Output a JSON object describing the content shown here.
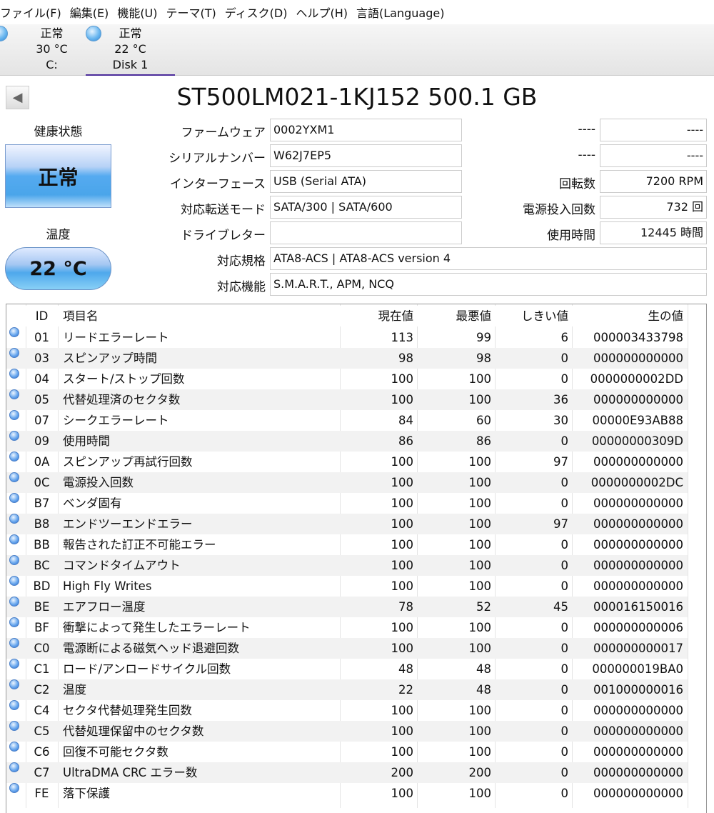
{
  "menu": [
    "ファイル(F)",
    "編集(E)",
    "機能(U)",
    "テーマ(T)",
    "ディスク(D)",
    "ヘルプ(H)",
    "言語(Language)"
  ],
  "disks": [
    {
      "status": "正常",
      "temp": "30 °C",
      "name": "C:"
    },
    {
      "status": "正常",
      "temp": "22 °C",
      "name": "Disk 1"
    }
  ],
  "title": "ST500LM021-1KJ152 500.1 GB",
  "health": {
    "label": "健康状態",
    "value": "正常"
  },
  "temperature": {
    "label": "温度",
    "value": "22 °C"
  },
  "info": {
    "firmware_label": "ファームウェア",
    "firmware": "0002YXM1",
    "serial_label": "シリアルナンバー",
    "serial": "W62J7EP5",
    "interface_label": "インターフェース",
    "interface": "USB (Serial ATA)",
    "transfer_label": "対応転送モード",
    "transfer": "SATA/300 | SATA/600",
    "drive_label": "ドライブレター",
    "drive": "",
    "standard_label": "対応規格",
    "standard": "ATA8-ACS | ATA8-ACS version 4",
    "features_label": "対応機能",
    "features": "S.M.A.R.T., APM, NCQ",
    "r1_label": "----",
    "r1": "----",
    "r2_label": "----",
    "r2": "----",
    "rpm_label": "回転数",
    "rpm": "7200 RPM",
    "power_count_label": "電源投入回数",
    "power_count": "732 回",
    "hours_label": "使用時間",
    "hours": "12445 時間"
  },
  "table": {
    "headers": [
      "",
      "ID",
      "項目名",
      "現在値",
      "最悪値",
      "しきい値",
      "生の値"
    ],
    "rows": [
      [
        "01",
        "リードエラーレート",
        "113",
        "99",
        "6",
        "000003433798"
      ],
      [
        "03",
        "スピンアップ時間",
        "98",
        "98",
        "0",
        "000000000000"
      ],
      [
        "04",
        "スタート/ストップ回数",
        "100",
        "100",
        "0",
        "0000000002DD"
      ],
      [
        "05",
        "代替処理済のセクタ数",
        "100",
        "100",
        "36",
        "000000000000"
      ],
      [
        "07",
        "シークエラーレート",
        "84",
        "60",
        "30",
        "00000E93AB88"
      ],
      [
        "09",
        "使用時間",
        "86",
        "86",
        "0",
        "00000000309D"
      ],
      [
        "0A",
        "スピンアップ再試行回数",
        "100",
        "100",
        "97",
        "000000000000"
      ],
      [
        "0C",
        "電源投入回数",
        "100",
        "100",
        "0",
        "0000000002DC"
      ],
      [
        "B7",
        "ベンダ固有",
        "100",
        "100",
        "0",
        "000000000000"
      ],
      [
        "B8",
        "エンドツーエンドエラー",
        "100",
        "100",
        "97",
        "000000000000"
      ],
      [
        "BB",
        "報告された訂正不可能エラー",
        "100",
        "100",
        "0",
        "000000000000"
      ],
      [
        "BC",
        "コマンドタイムアウト",
        "100",
        "100",
        "0",
        "000000000000"
      ],
      [
        "BD",
        "High Fly Writes",
        "100",
        "100",
        "0",
        "000000000000"
      ],
      [
        "BE",
        "エアフロー温度",
        "78",
        "52",
        "45",
        "000016150016"
      ],
      [
        "BF",
        "衝撃によって発生したエラーレート",
        "100",
        "100",
        "0",
        "000000000006"
      ],
      [
        "C0",
        "電源断による磁気ヘッド退避回数",
        "100",
        "100",
        "0",
        "000000000017"
      ],
      [
        "C1",
        "ロード/アンロードサイクル回数",
        "48",
        "48",
        "0",
        "000000019BA0"
      ],
      [
        "C2",
        "温度",
        "22",
        "48",
        "0",
        "001000000016"
      ],
      [
        "C4",
        "セクタ代替処理発生回数",
        "100",
        "100",
        "0",
        "000000000000"
      ],
      [
        "C5",
        "代替処理保留中のセクタ数",
        "100",
        "100",
        "0",
        "000000000000"
      ],
      [
        "C6",
        "回復不可能セクタ数",
        "100",
        "100",
        "0",
        "000000000000"
      ],
      [
        "C7",
        "UltraDMA CRC エラー数",
        "200",
        "200",
        "0",
        "000000000000"
      ],
      [
        "FE",
        "落下保護",
        "100",
        "100",
        "0",
        "000000000000"
      ]
    ]
  }
}
